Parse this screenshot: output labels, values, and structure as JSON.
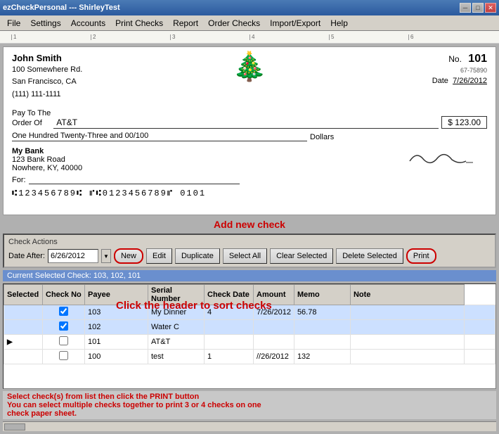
{
  "titleBar": {
    "title": "ezCheckPersonal --- ShirleyTest",
    "minBtn": "─",
    "maxBtn": "□",
    "closeBtn": "✕"
  },
  "menuBar": {
    "items": [
      "File",
      "Settings",
      "Accounts",
      "Print Checks",
      "Report",
      "Order Checks",
      "Import/Export",
      "Help"
    ]
  },
  "ruler": {
    "marks": [
      "1",
      "2",
      "3",
      "4",
      "5",
      "6"
    ]
  },
  "check": {
    "name": "John Smith",
    "address1": "100 Somewhere Rd.",
    "address2": "San Francisco, CA",
    "address3": "(111) 111-1111",
    "no_label": "No.",
    "no_value": "101",
    "routing": "67-75890",
    "date_label": "Date",
    "date_value": "7/26/2012",
    "pay_to_label": "Pay To The",
    "order_of_label": "Order Of",
    "payee": "AT&T",
    "dollar_sign": "$",
    "amount": "123.00",
    "written_amount": "One Hundred Twenty-Three and 00/100",
    "dollars_label": "Dollars",
    "bank_name": "My Bank",
    "bank_address1": "123 Bank Road",
    "bank_address2": "Nowhere, KY, 40000",
    "for_label": "For:",
    "micr": "⑆123456789⑆ ⑈⑆0123456789⑈ 0101"
  },
  "annotations": {
    "add_new_check": "Add new check",
    "sort_checks": "Click the header to sort checks",
    "print_instruction1": "Select check(s) from list then click the PRINT button",
    "print_instruction2": "You can select multiple checks together to print 3 or 4 checks on one",
    "print_instruction3": "check paper sheet."
  },
  "checkActions": {
    "title": "Check Actions",
    "date_after_label": "Date After:",
    "date_value": "6/26/2012",
    "buttons": {
      "new": "New",
      "edit": "Edit",
      "duplicate": "Duplicate",
      "select_all": "Select All",
      "clear_selected": "Clear Selected",
      "delete_selected": "Delete Selected",
      "print": "Print"
    }
  },
  "currentSelected": {
    "label": "Current Selected Check: 103, 102, 101"
  },
  "table": {
    "columns": [
      "Selected",
      "Check No",
      "Payee",
      "Serial Number",
      "Check Date",
      "Amount",
      "Memo",
      "Note"
    ],
    "rows": [
      {
        "selected": true,
        "checkNo": "103",
        "payee": "My Dinner",
        "serial": "4",
        "date": "7/26/2012",
        "amount": "56.78",
        "memo": "",
        "note": "",
        "arrow": false
      },
      {
        "selected": true,
        "checkNo": "102",
        "payee": "Water C",
        "serial": "",
        "date": "",
        "amount": "",
        "memo": "",
        "note": "",
        "arrow": false
      },
      {
        "selected": false,
        "checkNo": "101",
        "payee": "AT&T",
        "serial": "",
        "date": "",
        "amount": "",
        "memo": "",
        "note": "",
        "arrow": true
      },
      {
        "selected": false,
        "checkNo": "100",
        "payee": "test",
        "serial": "1",
        "date": "//26/2012",
        "amount": "132",
        "memo": "",
        "note": "",
        "arrow": false
      }
    ]
  }
}
